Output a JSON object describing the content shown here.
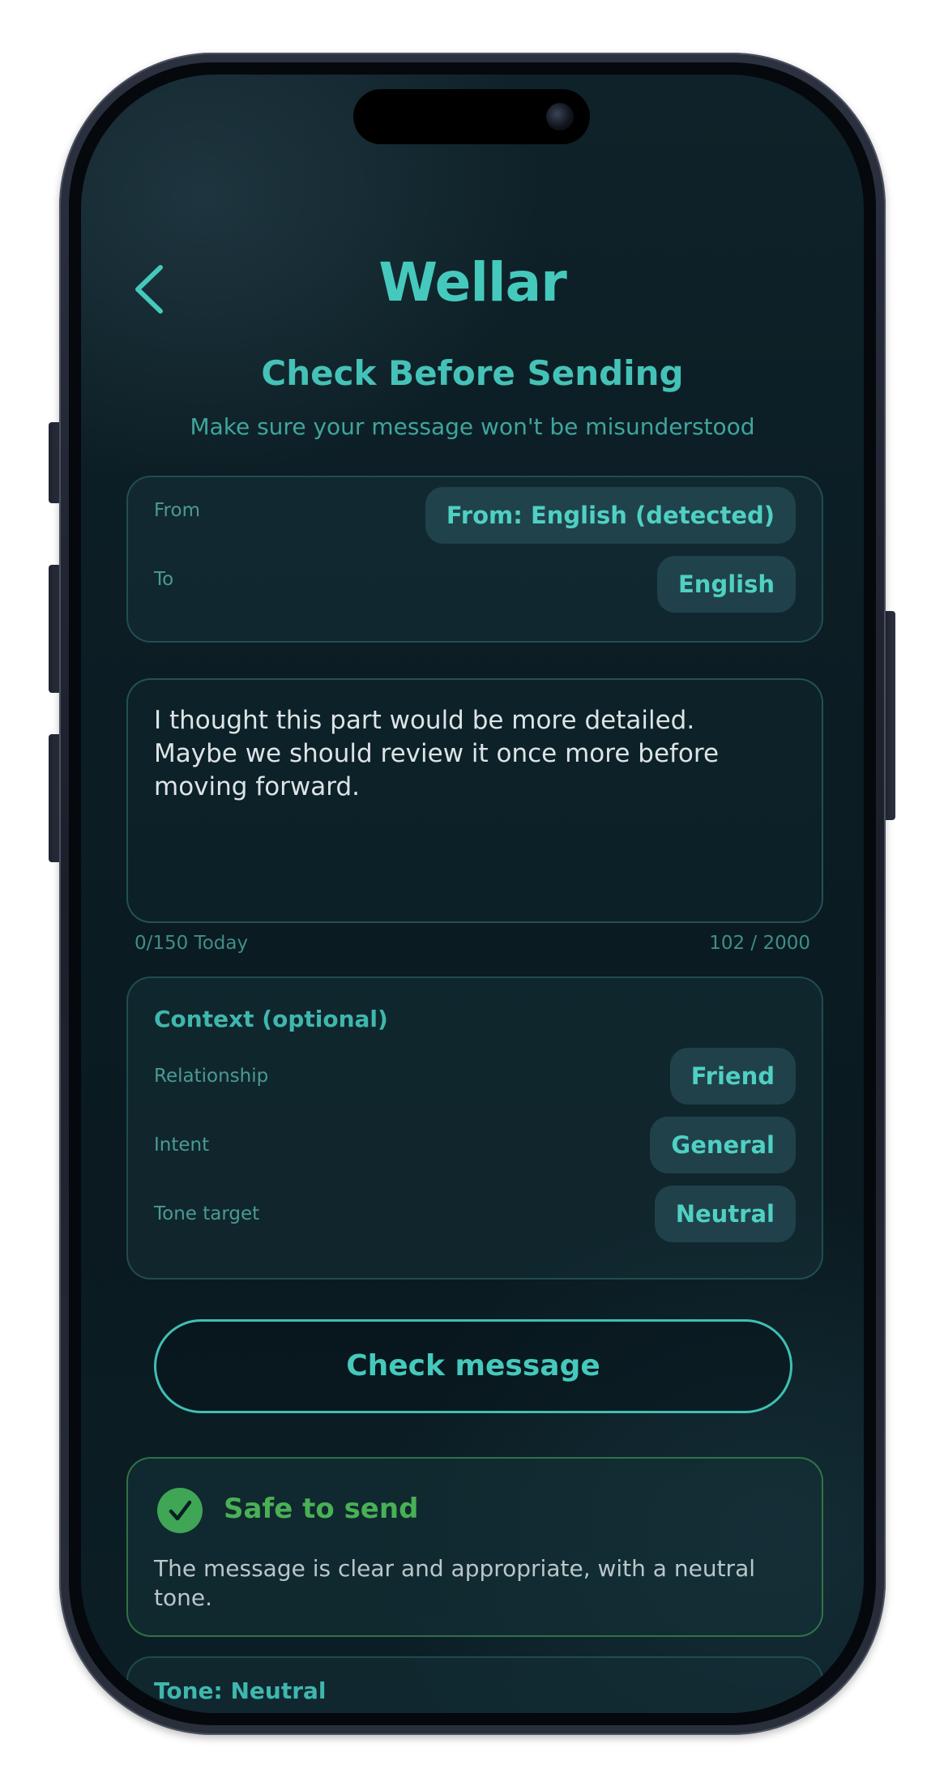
{
  "app": {
    "brand": "Wellar"
  },
  "header": {
    "title": "Check Before Sending",
    "subtitle": "Make sure your message won't be misunderstood"
  },
  "languages": {
    "from_label": "From",
    "from_value": "From: English (detected)",
    "to_label": "To",
    "to_value": "English"
  },
  "message": {
    "text": "I thought this part would be more detailed.\nMaybe we should review it once more before\nmoving forward.",
    "daily_usage": "0/150 Today",
    "char_count": "102 / 2000"
  },
  "context": {
    "title": "Context (optional)",
    "relationship_label": "Relationship",
    "relationship_value": "Friend",
    "intent_label": "Intent",
    "intent_value": "General",
    "tone_label": "Tone target",
    "tone_value": "Neutral"
  },
  "actions": {
    "check_label": "Check message"
  },
  "result": {
    "status": "Safe to send",
    "description": "The message is clear and appropriate, with a neutral tone.",
    "status_color": "#49b055"
  },
  "tone": {
    "label": "Tone: Neutral"
  },
  "theme": {
    "accent": "#45c9bd",
    "background": "#0b1c23"
  }
}
